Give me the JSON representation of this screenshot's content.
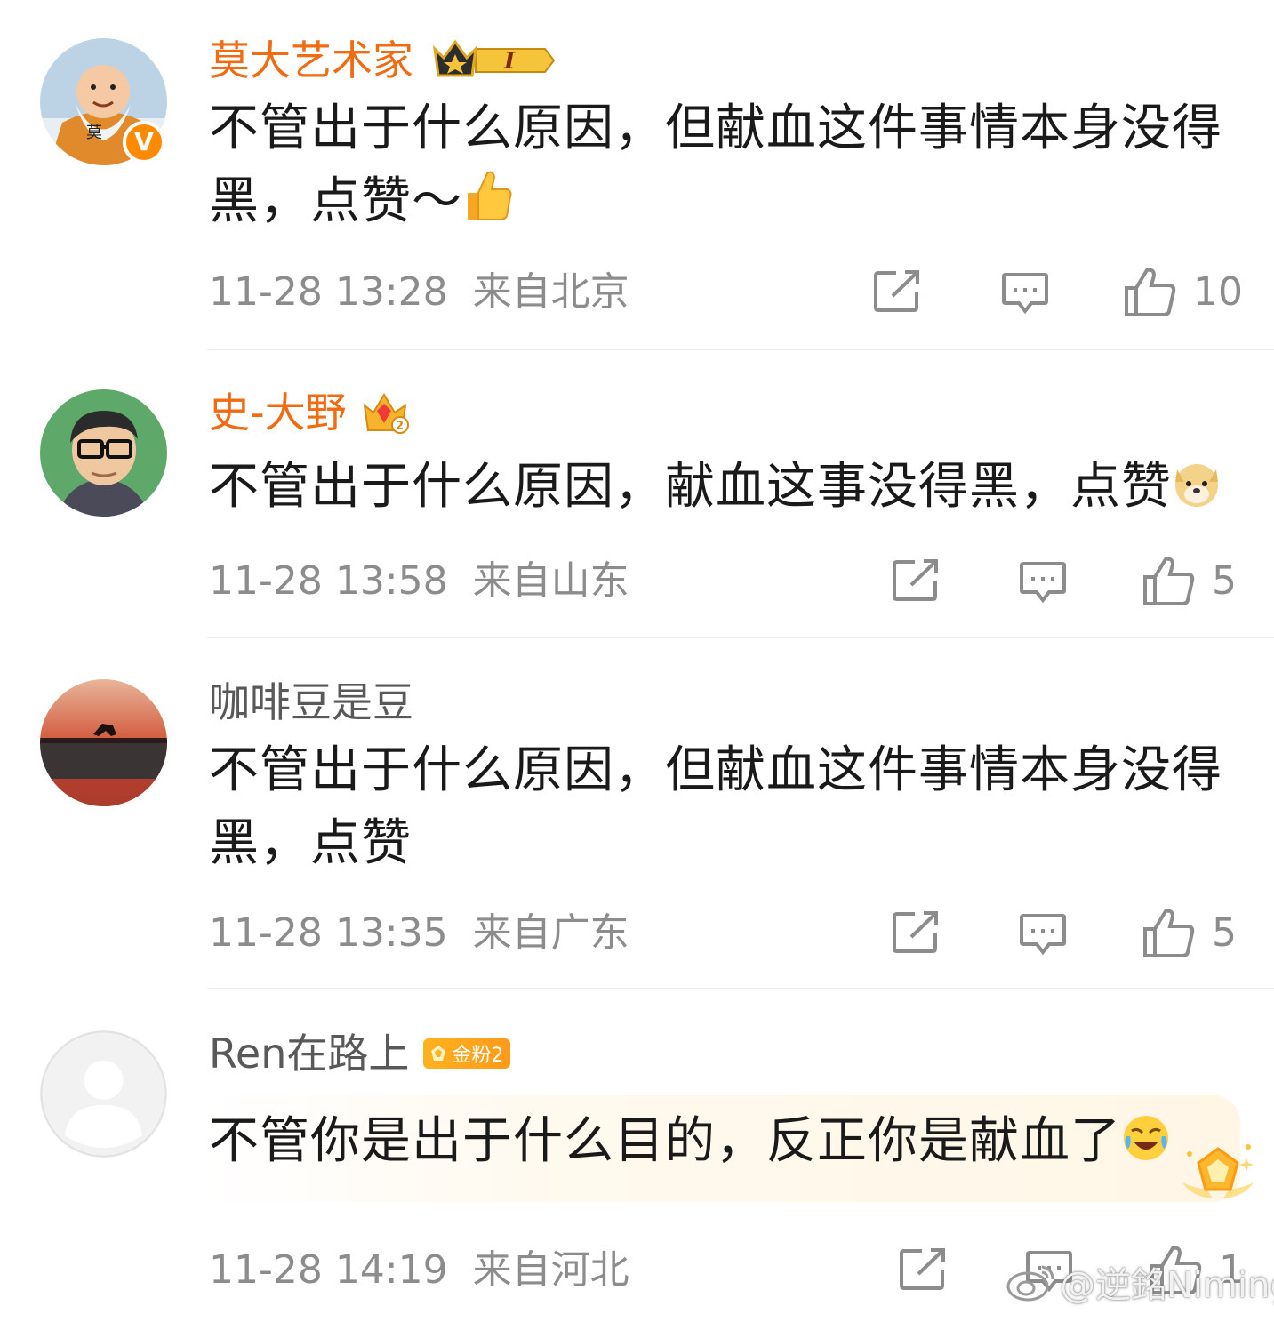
{
  "comments": [
    {
      "username": "莫大艺术家",
      "text": "不管出于什么原因，但献血这件事情本身没得黑，点赞～",
      "emoji": "thumbs-up-emoji",
      "time": "11-28 13:28",
      "location": "来自北京",
      "likes": "10",
      "badge": "crown-level-icon",
      "badge_text": "I"
    },
    {
      "username": "史-大野",
      "text": "不管出于什么原因，献血这事没得黑，点赞",
      "emoji": "doge-emoji",
      "time": "11-28 13:58",
      "location": "来自山东",
      "likes": "5",
      "badge": "crown-2-icon"
    },
    {
      "username": "咖啡豆是豆",
      "text": "不管出于什么原因，但献血这件事情本身没得黑，点赞",
      "time": "11-28 13:35",
      "location": "来自广东",
      "likes": "5"
    },
    {
      "username": "Ren在路上",
      "text": "不管你是出于什么目的，反正你是献血了",
      "emoji": "laugh-cry-emoji",
      "time": "11-28 14:19",
      "location": "来自河北",
      "likes": "1",
      "badge_label": "金粉2"
    }
  ],
  "watermark": "@逆銘Niming",
  "colors": {
    "vip_name": "#f06b12",
    "normal_name": "#595959",
    "meta": "#8c8c8c",
    "divider": "#ededed"
  }
}
